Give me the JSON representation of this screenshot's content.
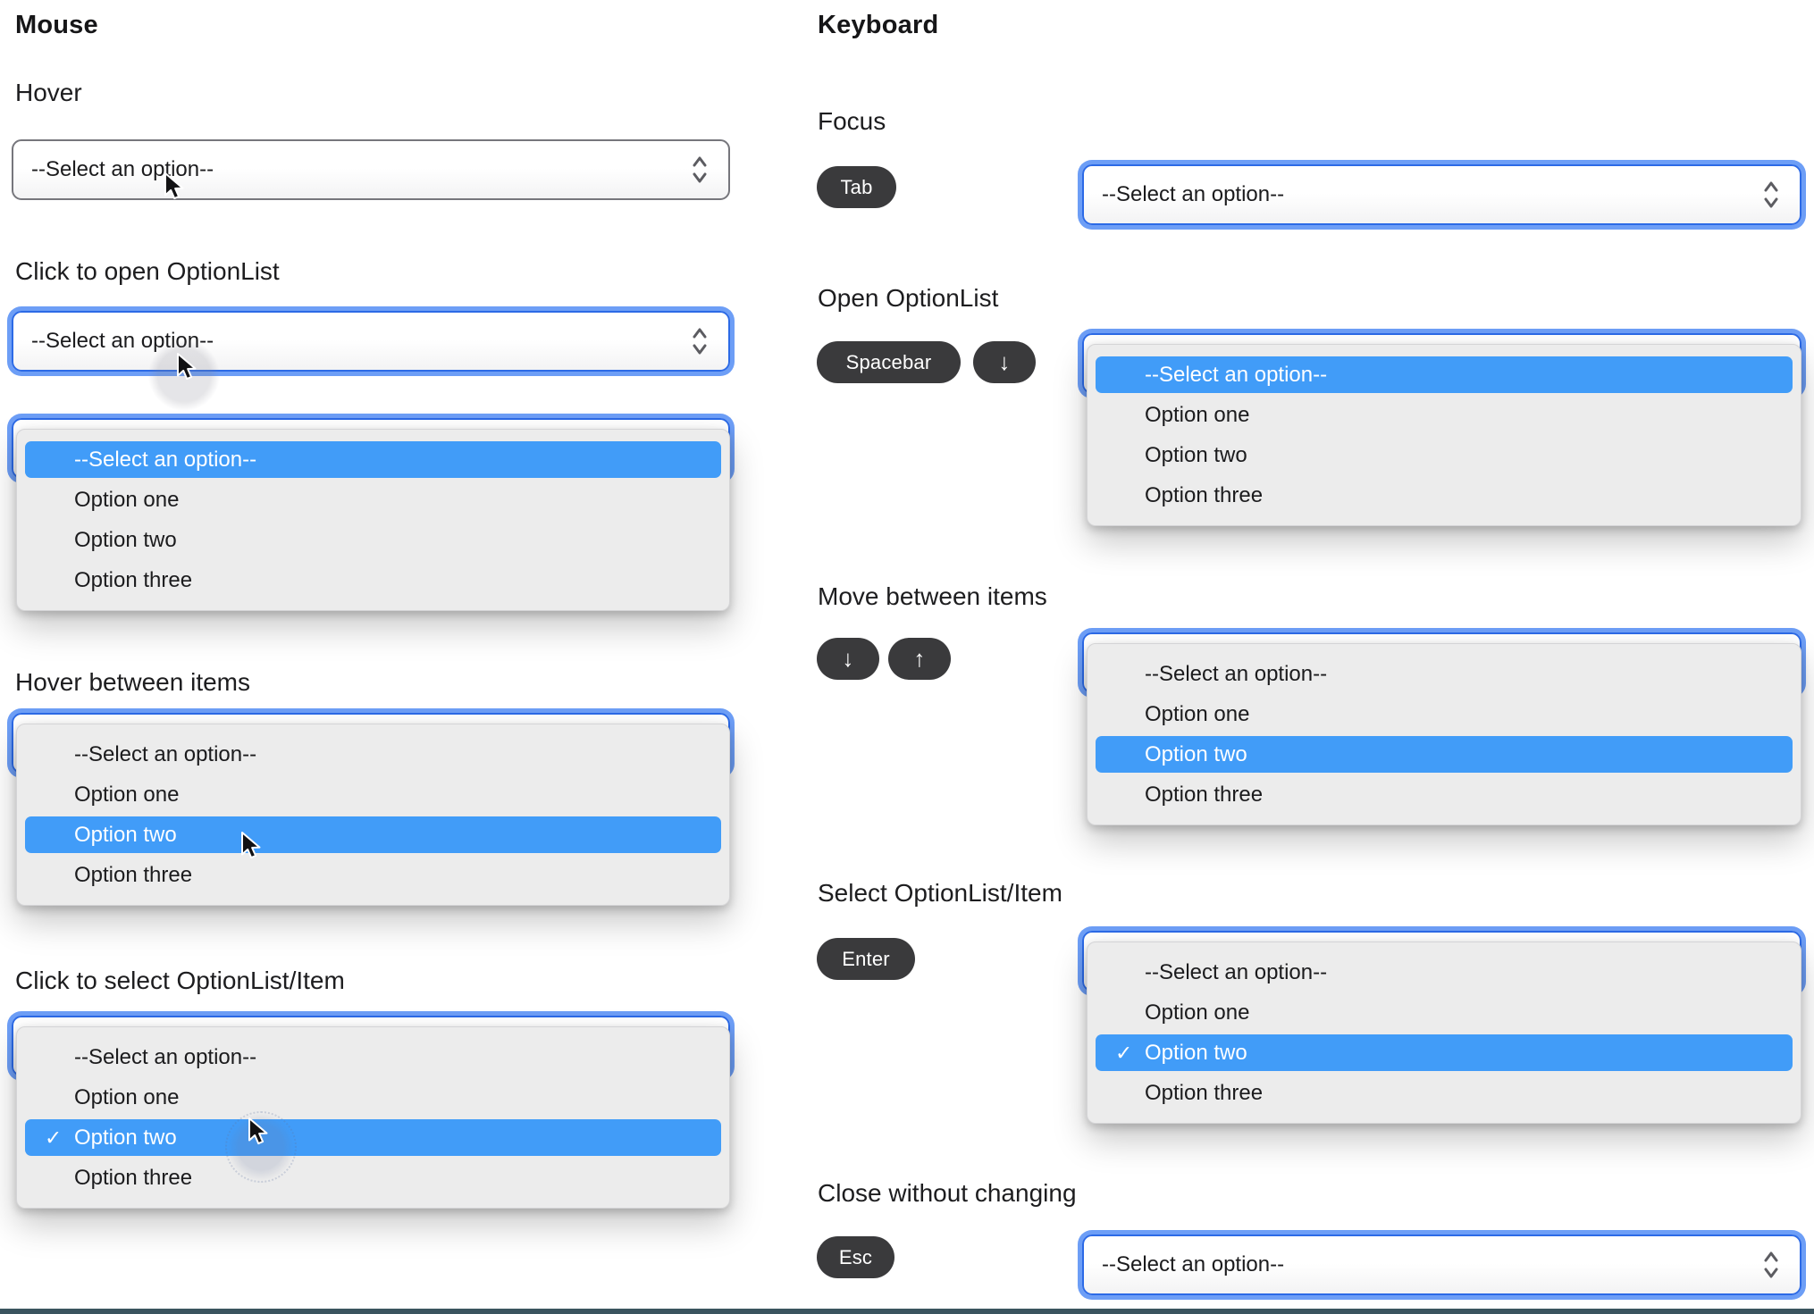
{
  "titles": {
    "mouse": "Mouse",
    "keyboard": "Keyboard"
  },
  "select": {
    "placeholder": "--Select an option--"
  },
  "options": [
    "--Select an option--",
    "Option one",
    "Option two",
    "Option three"
  ],
  "checkmark": "✓",
  "mouse_sections": {
    "hover": "Hover",
    "click_open": "Click to open OptionList",
    "hover_items": "Hover between items",
    "click_select": "Click to select OptionList/Item"
  },
  "keyboard_sections": {
    "focus": "Focus",
    "open": "Open OptionList",
    "move": "Move between items",
    "select": "Select OptionList/Item",
    "close": "Close without changing"
  },
  "keys": {
    "tab": "Tab",
    "spacebar": "Spacebar",
    "down": "↓",
    "up": "↑",
    "enter": "Enter",
    "esc": "Esc"
  },
  "colors": {
    "highlight": "#419CF8",
    "focus_border": "#2C6AE6",
    "focus_ring": "#6D9EF6",
    "key_bg": "#3A3A3C",
    "panel_bg": "#ECECEC",
    "bottom_bar": "#3A545F"
  }
}
